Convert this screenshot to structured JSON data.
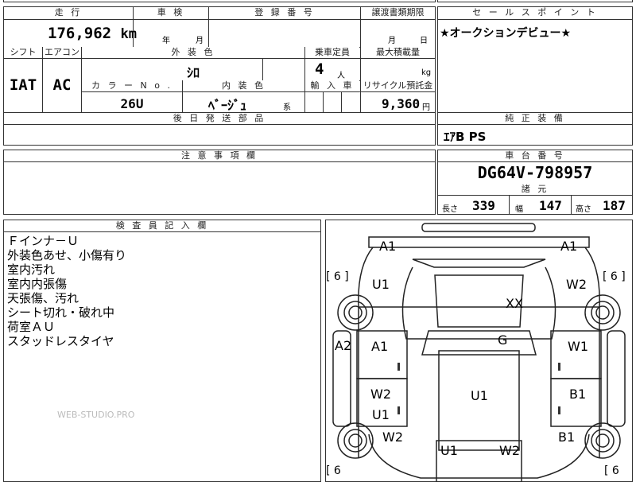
{
  "sheet": {
    "mileage_label": "走 行",
    "mileage": "176,962",
    "mileage_unit": "km",
    "inspection_label": "車 検",
    "inspection_year_unit": "年",
    "inspection_month_unit": "月",
    "registration_label": "登 録 番 号",
    "transfer_deadline_label": "譲渡書類期限",
    "transfer_month_unit": "月",
    "transfer_day_unit": "日",
    "shift_label": "シフト",
    "shift": "IAT",
    "aircon_label": "エアコン",
    "aircon": "AC",
    "exterior_color_label": "外 装 色",
    "exterior_color": "ｼﾛ",
    "capacity_label": "乗車定員",
    "capacity": "4",
    "capacity_unit": "人",
    "max_load_label": "最大積載量",
    "max_load_unit": "kg",
    "color_no_label": "カ ラ ー N o .",
    "color_no": "26U",
    "interior_color_label": "内 装 色",
    "interior_color": "ﾍﾞｰｼﾞｭ",
    "interior_color_suffix": "系",
    "import_label": "輸 入 車",
    "recycle_label": "リサイクル預託金",
    "recycle_fee": "9,360",
    "recycle_unit": "円",
    "later_parts_label": "後 日 発 送 部 品",
    "notes_label": "注 意 事 項 欄",
    "inspector_label": "検 査 員 記 入 欄",
    "inspector_notes": [
      "Ｆインナ－Ｕ",
      "外装色あせ、小傷有り",
      "室内汚れ",
      "室内内張傷",
      "天張傷、汚れ",
      "シート切れ・破れ中",
      "荷室ＡＵ",
      "スタッドレスタイヤ"
    ],
    "watermark": "WEB-STUDIO.PRO"
  },
  "sales": {
    "sales_point_label": "セ ー ル ス ポ イ ン ト",
    "sales_point": "★オークションデビュー★",
    "standard_equipment_label": "純 正 装 備",
    "standard_equipment": "ｴｱB PS",
    "chassis_label": "車 台 番 号",
    "chassis_no": "DG64V-798957",
    "specs_label": "諸 元",
    "length_label": "長さ",
    "length": "339",
    "width_label": "幅",
    "width": "147",
    "height_label": "高さ",
    "height": "187"
  },
  "diagram": {
    "marks": {
      "front_left": "A1",
      "front_right": "A1",
      "fender_left": "U1",
      "fender_right": "W2",
      "roof": "XX",
      "door_left_side": "A2",
      "front_door_left": "A1",
      "front_door_right": "W1",
      "windshield": "G",
      "rear_door_left": "W2",
      "rear_door_left_2": "U1",
      "rear_door_right": "B1",
      "cargo_floor": "U1",
      "rear_quarter_left": "W2",
      "rear_quarter_right": "B1",
      "rear_bumper_left": "U1",
      "rear_bumper_right": "W2"
    },
    "tire_left_front": "[ 6 ]",
    "tire_right_front": "[ 6 ]",
    "tire_left_rear": "[ 6",
    "tire_right_rear": "[ 6"
  }
}
